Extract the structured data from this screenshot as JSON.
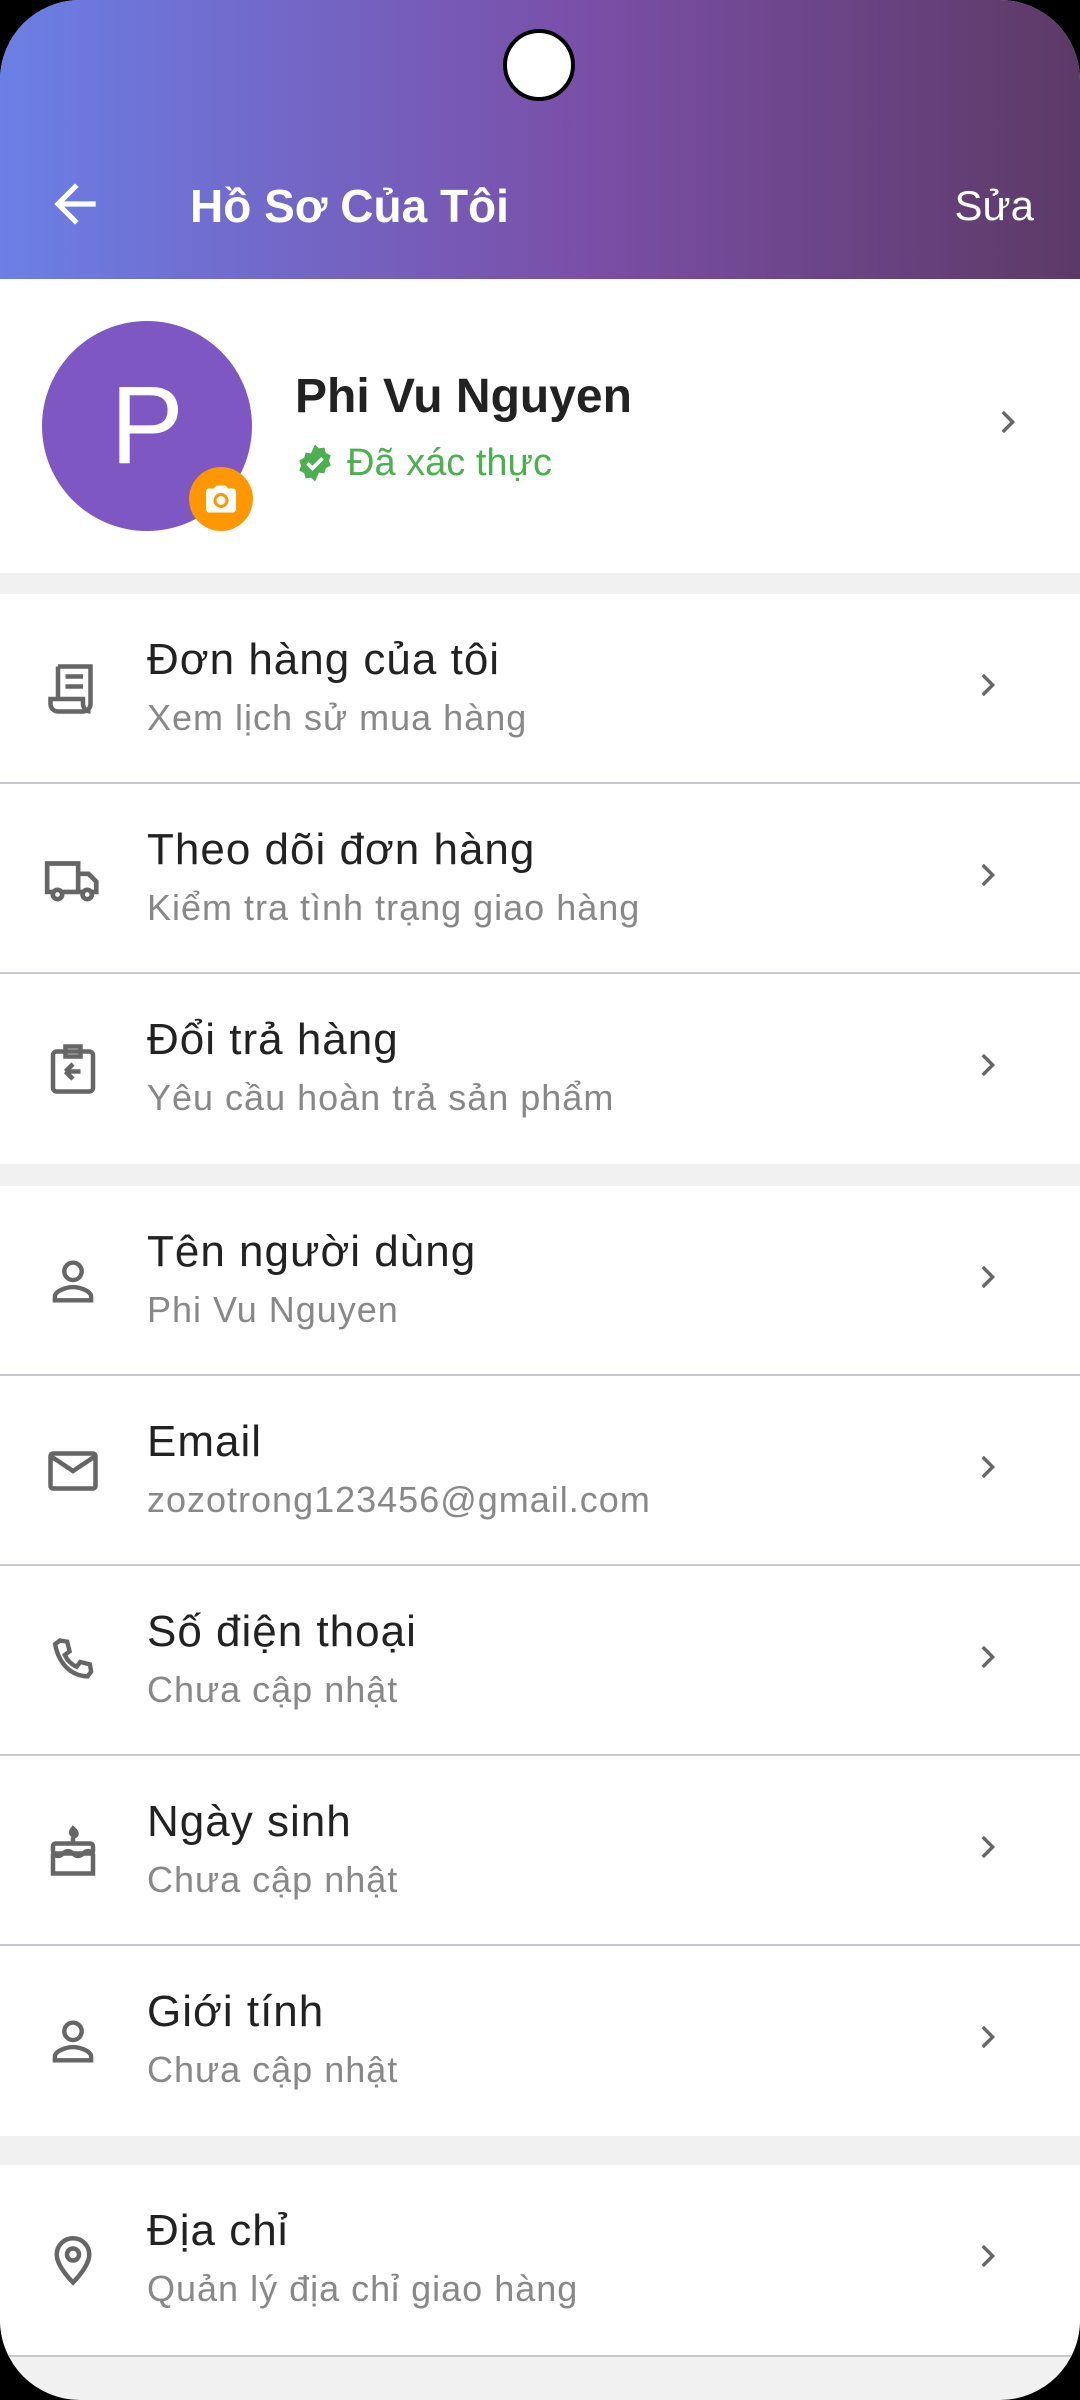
{
  "header": {
    "title": "Hồ Sơ Của Tôi",
    "edit_label": "Sửa"
  },
  "profile": {
    "avatar_letter": "P",
    "name": "Phi Vu Nguyen",
    "verified_label": "Đã xác thực"
  },
  "orders_section": [
    {
      "icon": "receipt-icon",
      "title": "Đơn hàng của tôi",
      "subtitle": "Xem lịch sử mua hàng"
    },
    {
      "icon": "truck-icon",
      "title": "Theo dõi đơn hàng",
      "subtitle": "Kiểm tra tình trạng giao hàng"
    },
    {
      "icon": "return-icon",
      "title": "Đổi trả hàng",
      "subtitle": "Yêu cầu hoàn trả sản phẩm"
    }
  ],
  "info_section": [
    {
      "icon": "person-icon",
      "title": "Tên người dùng",
      "subtitle": "Phi Vu Nguyen"
    },
    {
      "icon": "mail-icon",
      "title": "Email",
      "subtitle": "zozotrong123456@gmail.com"
    },
    {
      "icon": "phone-icon",
      "title": "Số điện thoại",
      "subtitle": "Chưa cập nhật"
    },
    {
      "icon": "cake-icon",
      "title": "Ngày sinh",
      "subtitle": "Chưa cập nhật"
    },
    {
      "icon": "person-icon",
      "title": "Giới tính",
      "subtitle": "Chưa cập nhật"
    }
  ],
  "address_section": [
    {
      "icon": "location-icon",
      "title": "Địa chỉ",
      "subtitle": "Quản lý địa chỉ giao hàng"
    }
  ],
  "colors": {
    "accent_gradient_start": "#6b7fe6",
    "accent_gradient_end": "#5c3a66",
    "avatar_bg": "#7e57c2",
    "camera_badge": "#ff9800",
    "verified": "#4caf50"
  }
}
